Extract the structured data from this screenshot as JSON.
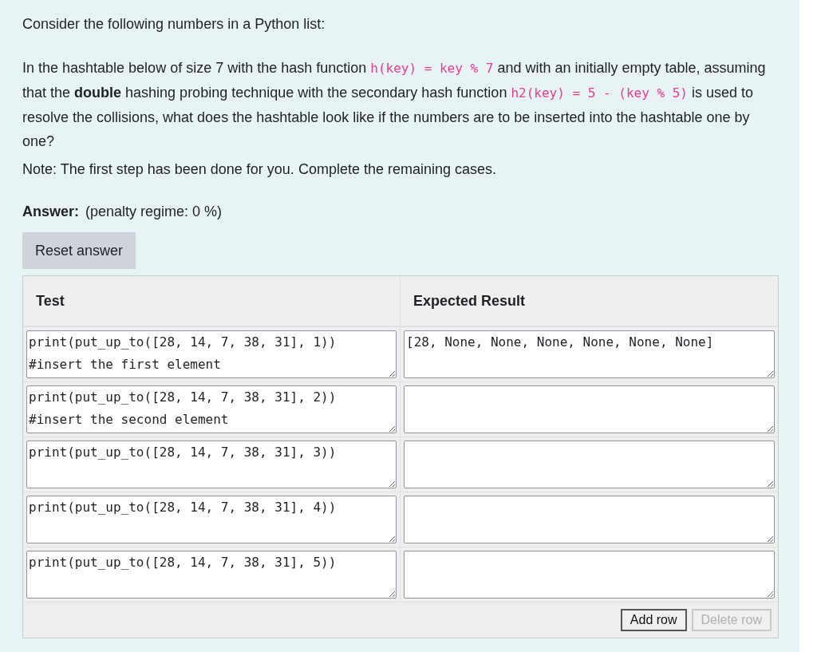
{
  "intro": "Consider the following numbers in a Python list:",
  "question": [
    {
      "kind": "text",
      "text": "In the hashtable below of size 7 with the hash function "
    },
    {
      "kind": "code",
      "text": "h(key) = key % 7"
    },
    {
      "kind": "text",
      "text": " and with an initially empty table, assuming that the "
    },
    {
      "kind": "bold",
      "text": "double"
    },
    {
      "kind": "text",
      "text": " hashing probing technique with the secondary hash function "
    },
    {
      "kind": "code",
      "text": "h2(key) = 5 - (key % 5)"
    },
    {
      "kind": "text",
      "text": " is used to resolve the collisions, what does the hashtable look like if the numbers are to be inserted into the hashtable one by one?"
    }
  ],
  "note": "Note: The first step has been done for you. Complete the remaining cases.",
  "answer_label": "Answer:",
  "penalty": "(penalty regime: 0 %)",
  "reset_button": "Reset answer",
  "table": {
    "columns": [
      "Test",
      "Expected Result"
    ],
    "rows": [
      {
        "test": "print(put_up_to([28, 14, 7, 38, 31], 1)) #insert the first element",
        "expected": "[28, None, None, None, None, None, None]"
      },
      {
        "test": "print(put_up_to([28, 14, 7, 38, 31], 2)) #insert the second element",
        "expected": ""
      },
      {
        "test": "print(put_up_to([28, 14, 7, 38, 31], 3))",
        "expected": ""
      },
      {
        "test": "print(put_up_to([28, 14, 7, 38, 31], 4))",
        "expected": ""
      },
      {
        "test": "print(put_up_to([28, 14, 7, 38, 31], 5))",
        "expected": ""
      }
    ]
  },
  "buttons": [
    {
      "label": "Add row",
      "disabled": false
    },
    {
      "label": "Delete row",
      "disabled": true
    }
  ]
}
